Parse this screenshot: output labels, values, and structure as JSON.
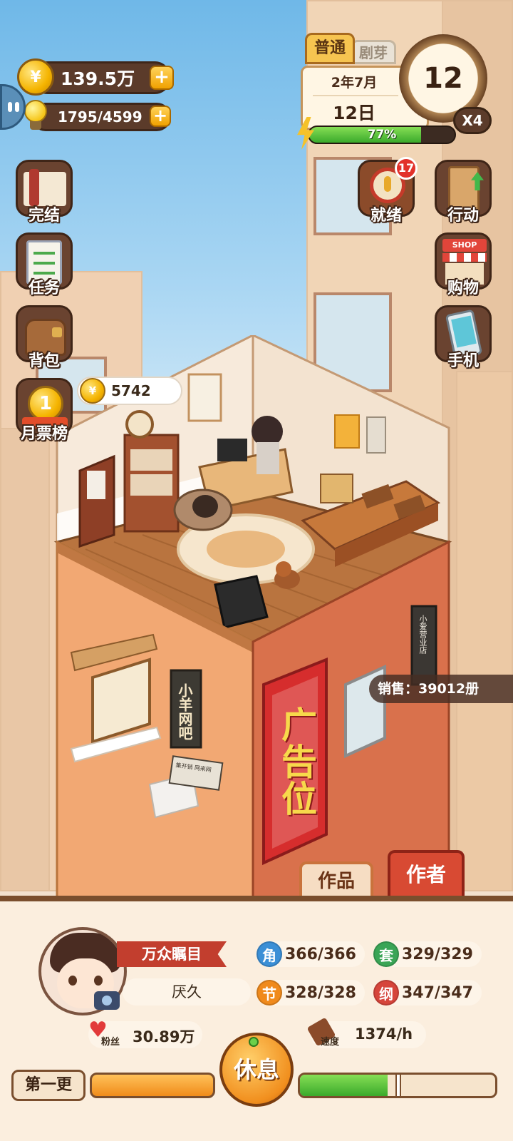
{
  "currency": {
    "coins": "139.5万",
    "energy": "1795/4599"
  },
  "date_panel": {
    "mode": "普通",
    "mode_secondary": "剧芽",
    "year_month": "2年7月",
    "day": "12日",
    "clock_number": "12",
    "speed_multiplier": "X4",
    "energy_percent_label": "77%",
    "energy_percent": 0.77
  },
  "left_menu": [
    {
      "label": "完结",
      "icon": "book-icon"
    },
    {
      "label": "任务",
      "icon": "checklist-icon"
    },
    {
      "label": "背包",
      "icon": "bag-icon"
    },
    {
      "label": "月票榜",
      "icon": "medal-icon"
    }
  ],
  "right_menu": [
    {
      "label": "就绪",
      "icon": "wheel-icon",
      "badge": "17"
    },
    {
      "label": "行动",
      "icon": "door-icon"
    },
    {
      "label": "购物",
      "icon": "shop-icon",
      "sign": "SHOP"
    },
    {
      "label": "手机",
      "icon": "phone-icon"
    }
  ],
  "room": {
    "coin_bubble": "5742",
    "sales": "销售：39012册",
    "shop_sign": "小羊网吧",
    "shop_sign_small": "集开销  网来网",
    "ad_board": "广告位",
    "side_sign": "小爱营业店"
  },
  "tabs": {
    "works": "作品",
    "author": "作者"
  },
  "profile": {
    "title": "万众瞩目",
    "name": "厌久",
    "fans_label": "粉丝",
    "fans": "30.89万",
    "speed_label": "速度",
    "speed": "1374/h"
  },
  "stats": [
    {
      "badge": "角",
      "value": "366/366",
      "color": "#3b8fd6"
    },
    {
      "badge": "套",
      "value": "329/329",
      "color": "#3aa556"
    },
    {
      "badge": "节",
      "value": "328/328",
      "color": "#f08a1c"
    },
    {
      "badge": "纲",
      "value": "347/347",
      "color": "#d6453b"
    }
  ],
  "bottom_bar": {
    "chapter": "第一更",
    "rest_button": "休息",
    "progress_left": 1.0,
    "progress_right": 0.45
  }
}
